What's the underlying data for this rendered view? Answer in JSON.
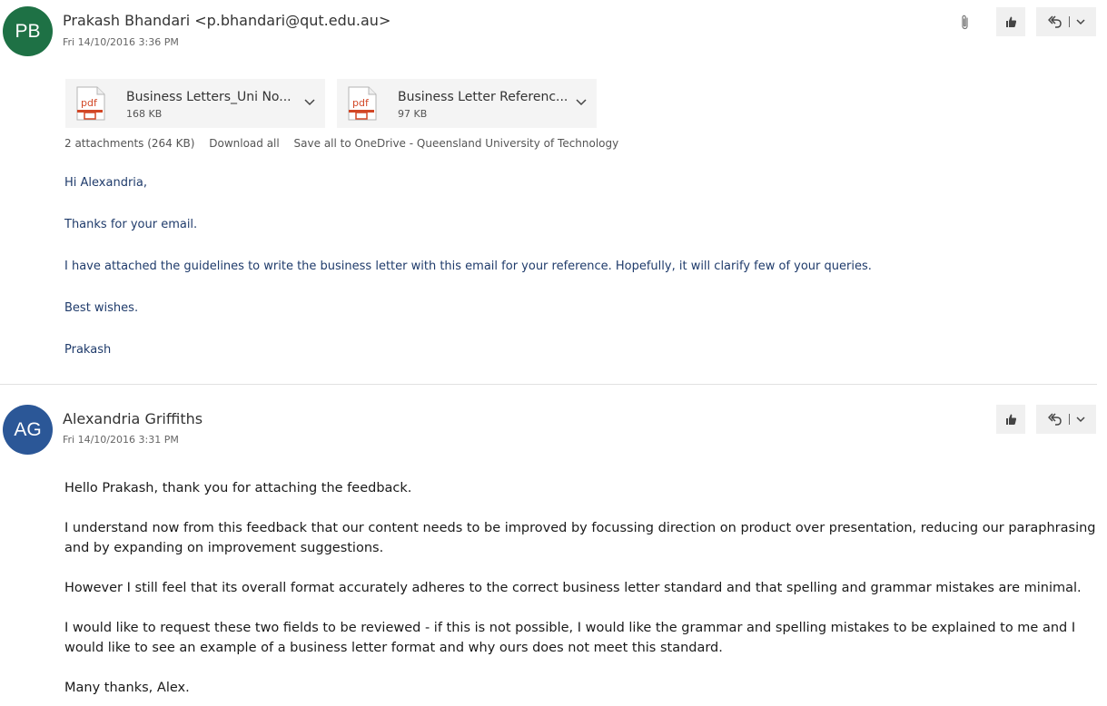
{
  "messages": [
    {
      "avatar": {
        "initials": "PB",
        "color": "#1e7145"
      },
      "sender": "Prakash Bhandari <p.bhandari@qut.edu.au>",
      "date": "Fri 14/10/2016 3:36 PM",
      "attachments": [
        {
          "name": "Business Letters_Uni No...",
          "size": "168 KB",
          "icon": "pdf-icon"
        },
        {
          "name": "Business Letter Referenc...",
          "size": "97 KB",
          "icon": "pdf-icon"
        }
      ],
      "attachment_summary": "2 attachments (264 KB)",
      "download_all": "Download all",
      "save_all": "Save all to OneDrive - Queensland University of Technology",
      "body": [
        "Hi Alexandria,",
        "Thanks for your email.",
        "I have attached the guidelines to write the business letter with this email for your reference. Hopefully, it will clarify few of your queries.",
        "Best wishes.",
        "Prakash"
      ]
    },
    {
      "avatar": {
        "initials": "AG",
        "color": "#2b5797"
      },
      "sender": "Alexandria Griffiths",
      "date": "Fri 14/10/2016 3:31 PM",
      "body": [
        "Hello Prakash, thank you for attaching the feedback.",
        "I understand now from this feedback that our content needs to be improved by focussing direction on product over presentation, reducing our paraphrasing and by expanding on improvement suggestions.",
        "However I still feel that its overall format accurately adheres to the correct business letter standard and that spelling and grammar mistakes are minimal.",
        "I would like to request these two fields to be reviewed - if this is not possible, I would like the grammar and spelling mistakes to be explained to me and I would like to see an example of a business letter format and why ours does not meet this standard.",
        "Many thanks, Alex."
      ]
    }
  ],
  "icons": {
    "attachment": "paperclip-icon",
    "like": "thumbs-up-icon",
    "reply_all": "reply-all-icon",
    "more": "chevron-down-icon"
  },
  "colors": {
    "body_link_blue": "#1f3b6b",
    "pdf_red": "#d24726"
  }
}
